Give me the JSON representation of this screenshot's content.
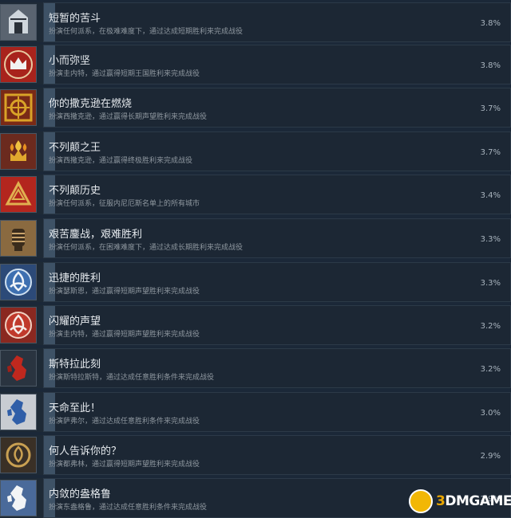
{
  "accent_bar_color": "#3e5266",
  "achievements": [
    {
      "title": "短暂的苦斗",
      "description": "扮演任何派系，在极难难度下，通过达成短期胜利来完成战役",
      "percent": "3.8%",
      "fill": 0.038,
      "icon": "castle-gate-icon"
    },
    {
      "title": "小而弥坚",
      "description": "扮演圭内特，通过赢得短期王国胜利来完成战役",
      "percent": "3.8%",
      "fill": 0.038,
      "icon": "crown-icon"
    },
    {
      "title": "你的撒克逊在燃烧",
      "description": "扮演西撒克逊，通过赢得长期声望胜利来完成战役",
      "percent": "3.7%",
      "fill": 0.037,
      "icon": "celtic-knot-icon"
    },
    {
      "title": "不列颠之王",
      "description": "扮演西撒克逊，通过赢得终极胜利来完成战役",
      "percent": "3.7%",
      "fill": 0.037,
      "icon": "flaming-crown-icon"
    },
    {
      "title": "不列颠历史",
      "description": "扮演任何派系，征服内尼厄斯名单上的所有城市",
      "percent": "3.4%",
      "fill": 0.034,
      "icon": "triangle-knot-icon"
    },
    {
      "title": "艰苦鏖战，艰难胜利",
      "description": "扮演任何派系，在困难难度下，通过达成长期胜利来完成战役",
      "percent": "3.3%",
      "fill": 0.033,
      "icon": "armored-fist-icon"
    },
    {
      "title": "迅捷的胜利",
      "description": "扮演瑟斯恩，通过赢得短期声望胜利来完成战役",
      "percent": "3.3%",
      "fill": 0.033,
      "icon": "triquetra-blue-icon"
    },
    {
      "title": "闪耀的声望",
      "description": "扮演圭内特，通过赢得短期声望胜利来完成战役",
      "percent": "3.2%",
      "fill": 0.032,
      "icon": "triquetra-red-icon"
    },
    {
      "title": "斯特拉此刻",
      "description": "扮演斯特拉斯特，通过达成任意胜利条件来完成战役",
      "percent": "3.2%",
      "fill": 0.032,
      "icon": "britain-map-red-icon"
    },
    {
      "title": "天命至此！",
      "description": "扮演萨弗尔，通过达成任意胜利条件来完成战役",
      "percent": "3.0%",
      "fill": 0.03,
      "icon": "britain-map-blue-icon"
    },
    {
      "title": "何人告诉你的？",
      "description": "扮演都弗林，通过赢得短期声望胜利来完成战役",
      "percent": "2.9%",
      "fill": 0.029,
      "icon": "knot-circle-icon"
    },
    {
      "title": "内敛的盎格鲁",
      "description": "扮演东盎格鲁，通过达成任意胜利条件来完成战役",
      "percent": "2.9%",
      "fill": 0.029,
      "icon": "britain-map-white-icon"
    }
  ],
  "watermark": {
    "prefix": "3",
    "text": "DMGAME"
  }
}
